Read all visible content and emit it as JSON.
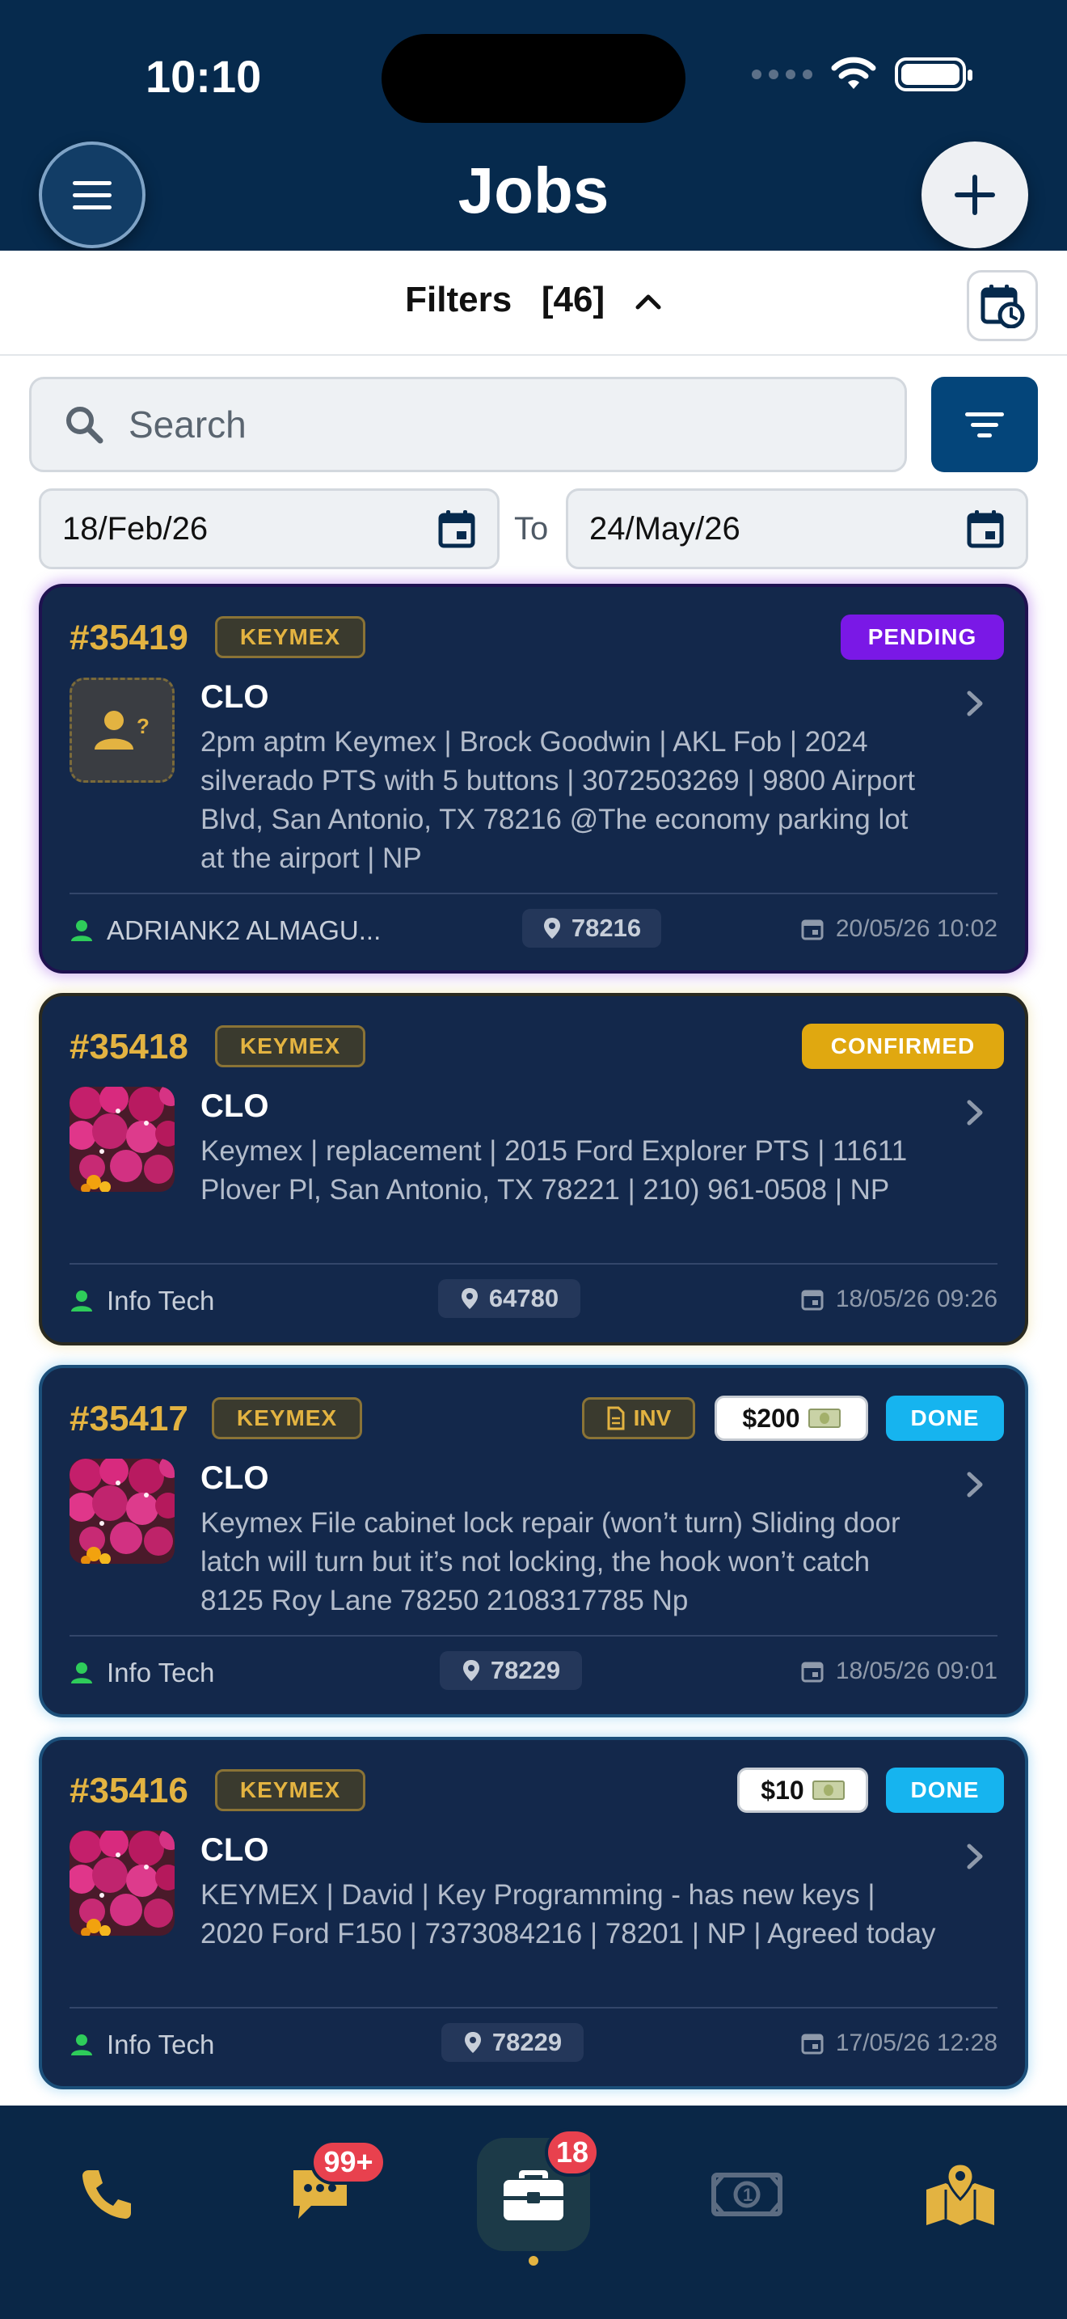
{
  "status_bar": {
    "time": "10:10"
  },
  "header": {
    "title": "Jobs"
  },
  "filters": {
    "label": "Filters",
    "count": "[46]"
  },
  "search": {
    "placeholder": "Search"
  },
  "date_range": {
    "from": "18/Feb/26",
    "to_label": "To",
    "to": "24/May/26"
  },
  "jobs": [
    {
      "number": "#35419",
      "brand": "KEYMEX",
      "status": "PENDING",
      "status_color": "#7a18e6",
      "title": "CLO",
      "description": "2pm aptm Keymex | Brock Goodwin | AKL Fob | 2024 silverado PTS with 5 buttons | 3072503269 | 9800 Airport Blvd, San Antonio, TX 78216 @The economy parking lot at the airport | NP",
      "assignee": "ADRIANK2 ALMAGU...",
      "zip": "78216",
      "date": "20/05/26 10:02",
      "thumbnail": "unknown-customer-icon"
    },
    {
      "number": "#35418",
      "brand": "KEYMEX",
      "status": "CONFIRMED",
      "status_color": "#e0a810",
      "title": "CLO",
      "description": "Keymex | replacement | 2015 Ford Explorer PTS | 11611 Plover Pl, San Antonio, TX 78221 | 210) 961-0508 | NP",
      "assignee": "Info Tech",
      "zip": "64780",
      "date": "18/05/26 09:26",
      "thumbnail": "flower-photo"
    },
    {
      "number": "#35417",
      "brand": "KEYMEX",
      "invoice": "INV",
      "price": "$200",
      "status": "DONE",
      "status_color": "#16b4ef",
      "title": "CLO",
      "description": "Keymex File cabinet lock repair (won’t turn) Sliding door latch will turn but it’s not locking, the hook won’t catch 8125 Roy Lane 78250 2108317785 Np",
      "assignee": "Info Tech",
      "zip": "78229",
      "date": "18/05/26 09:01",
      "thumbnail": "flower-photo"
    },
    {
      "number": "#35416",
      "brand": "KEYMEX",
      "price": "$10",
      "status": "DONE",
      "status_color": "#16b4ef",
      "title": "CLO",
      "description": "KEYMEX | David | Key Programming - has new keys | 2020 Ford F150 | 7373084216 | 78201 | NP | Agreed today",
      "assignee": "Info Tech",
      "zip": "78229",
      "date": "17/05/26 12:28",
      "thumbnail": "flower-photo"
    }
  ],
  "bottom_nav": {
    "items": [
      "phone-icon",
      "chat-icon",
      "briefcase-icon",
      "cash-icon",
      "map-icon"
    ],
    "chat_badge": "99+",
    "jobs_badge": "18",
    "accent": "#e3b341"
  }
}
